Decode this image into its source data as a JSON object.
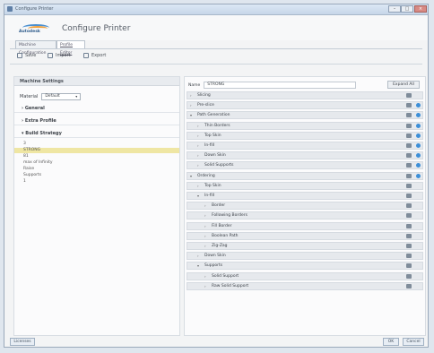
{
  "window": {
    "title": "Configure Printer"
  },
  "header": {
    "brand": "Autodesk",
    "title": "Configure Printer"
  },
  "tabs": [
    {
      "label": "Machine Configuration"
    },
    {
      "label": "Profile Editor"
    }
  ],
  "toolbar": {
    "save": "Save",
    "import": "Import",
    "export": "Export"
  },
  "left": {
    "header": "Machine Settings",
    "material_label": "Material",
    "material_value": "Default",
    "rows": [
      {
        "label": "General"
      },
      {
        "label": "Extra Profile"
      },
      {
        "label": "Build Strategy"
      }
    ],
    "subitems": [
      "3",
      "STRONG",
      "81",
      "max of Infinity",
      "Raise",
      "Supports",
      "1"
    ]
  },
  "right": {
    "name_label": "Name",
    "name_value": "STRONG",
    "expand_label": "Expand All",
    "rows": [
      {
        "label": "Slicing",
        "arrow": "›",
        "indent": 0,
        "dot": false
      },
      {
        "label": "Pre-slice",
        "arrow": "›",
        "indent": 0,
        "dot": true
      },
      {
        "label": "Path Generation",
        "arrow": "▾",
        "indent": 0,
        "dot": true
      },
      {
        "label": "Thin Borders",
        "arrow": "›",
        "indent": 1,
        "dot": true
      },
      {
        "label": "Top Skin",
        "arrow": "›",
        "indent": 1,
        "dot": true
      },
      {
        "label": "In-fill",
        "arrow": "›",
        "indent": 1,
        "dot": true
      },
      {
        "label": "Down Skin",
        "arrow": "›",
        "indent": 1,
        "dot": true
      },
      {
        "label": "Solid Supports",
        "arrow": "›",
        "indent": 1,
        "dot": true
      },
      {
        "label": "Ordering",
        "arrow": "▾",
        "indent": 0,
        "dot": true
      },
      {
        "label": "Top Skin",
        "arrow": "›",
        "indent": 1,
        "dot": false
      },
      {
        "label": "In-fill",
        "arrow": "▾",
        "indent": 1,
        "dot": false
      },
      {
        "label": "Border",
        "arrow": "›",
        "indent": 2,
        "dot": false
      },
      {
        "label": "Following Borders",
        "arrow": "›",
        "indent": 2,
        "dot": false
      },
      {
        "label": "Fill Border",
        "arrow": "›",
        "indent": 2,
        "dot": false
      },
      {
        "label": "Boolean Path",
        "arrow": "›",
        "indent": 2,
        "dot": false
      },
      {
        "label": "Zig-Zag",
        "arrow": "›",
        "indent": 2,
        "dot": false
      },
      {
        "label": "Down Skin",
        "arrow": "›",
        "indent": 1,
        "dot": false
      },
      {
        "label": "Supports",
        "arrow": "▾",
        "indent": 1,
        "dot": false
      },
      {
        "label": "Solid Support",
        "arrow": "›",
        "indent": 2,
        "dot": false
      },
      {
        "label": "Raw Solid Support",
        "arrow": "›",
        "indent": 2,
        "dot": false
      }
    ]
  },
  "footer": {
    "left": "Licenses",
    "ok": "OK",
    "cancel": "Cancel"
  },
  "colors": {
    "accent": "#3d8fd8",
    "selection": "#efe6a3"
  }
}
